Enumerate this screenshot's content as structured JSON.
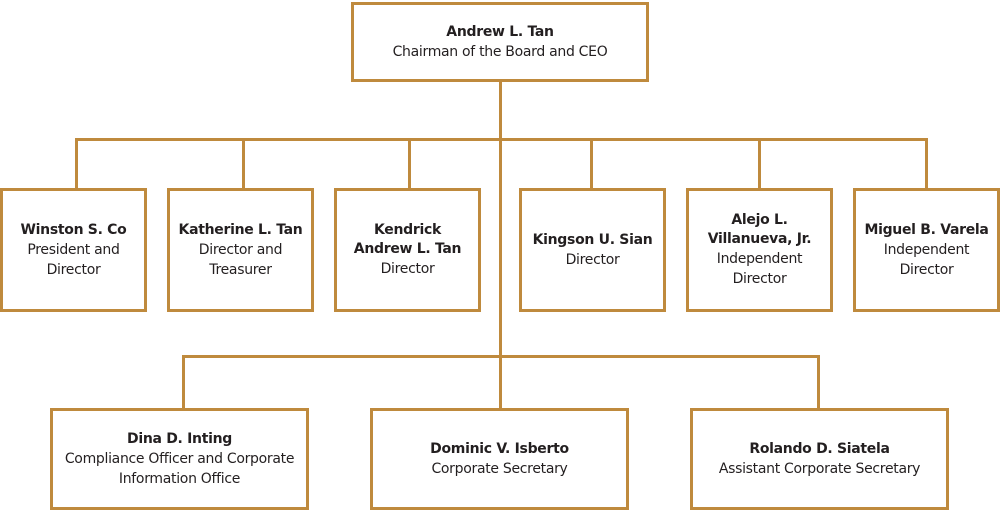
{
  "top": {
    "name": "Andrew L. Tan",
    "role": "Chairman of the Board and CEO"
  },
  "board": [
    {
      "name": "Winston S. Co",
      "role": "President and Director"
    },
    {
      "name": "Katherine L. Tan",
      "role": "Director and Treasurer"
    },
    {
      "name": "Kendrick Andrew L. Tan",
      "role": "Director"
    },
    {
      "name": "Kingson U. Sian",
      "role": "Director"
    },
    {
      "name": "Alejo L. Villanueva, Jr.",
      "role": "Independent Director"
    },
    {
      "name": "Miguel B. Varela",
      "role": "Independent Director"
    }
  ],
  "officers": [
    {
      "name": "Dina D. Inting",
      "role": "Compliance Officer and Corporate Information Office"
    },
    {
      "name": "Dominic V. Isberto",
      "role": "Corporate Secretary"
    },
    {
      "name": "Rolando D. Siatela",
      "role": "Assistant Corporate Secretary"
    }
  ],
  "colors": {
    "line": "#bf8a3d",
    "text": "#231f20"
  }
}
